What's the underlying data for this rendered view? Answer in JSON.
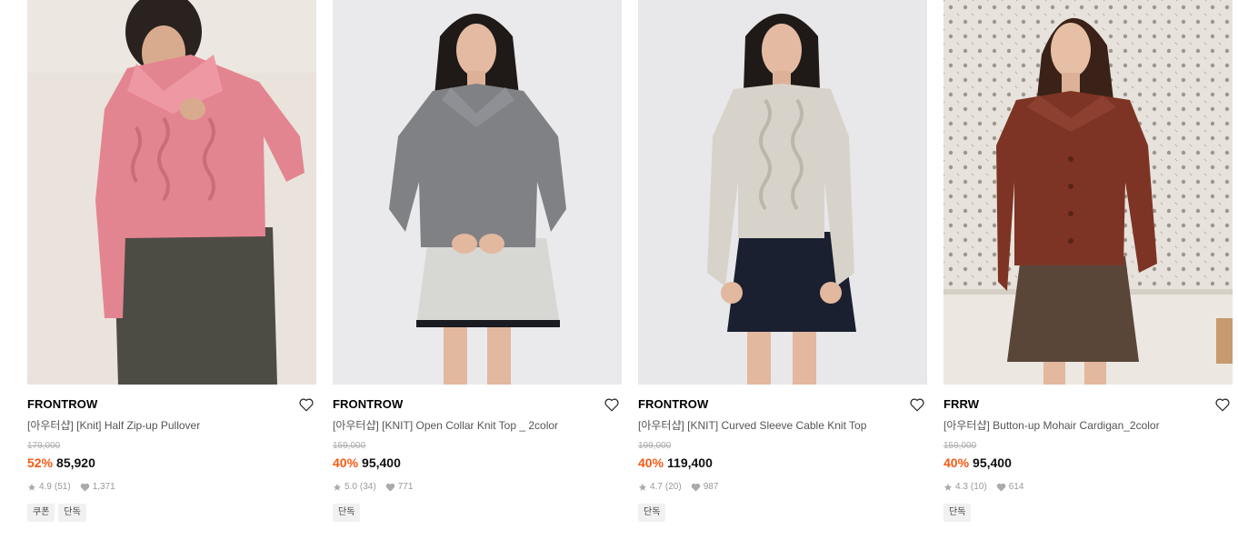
{
  "products": [
    {
      "brand": "FRONTROW",
      "title": "[아우터샵] [Knit] Half Zip-up Pullover",
      "original_price": "179,000",
      "discount": "52%",
      "price": "85,920",
      "rating": "4.9",
      "reviews": "(51)",
      "likes": "1,371",
      "tags": [
        "쿠폰",
        "단독"
      ]
    },
    {
      "brand": "FRONTROW",
      "title": "[아우터샵] [KNIT] Open Collar Knit Top _ 2color",
      "original_price": "159,000",
      "discount": "40%",
      "price": "95,400",
      "rating": "5.0",
      "reviews": "(34)",
      "likes": "771",
      "tags": [
        "단독"
      ]
    },
    {
      "brand": "FRONTROW",
      "title": "[아우터샵] [KNIT] Curved Sleeve Cable Knit Top",
      "original_price": "199,000",
      "discount": "40%",
      "price": "119,400",
      "rating": "4.7",
      "reviews": "(20)",
      "likes": "987",
      "tags": [
        "단독"
      ]
    },
    {
      "brand": "FRRW",
      "title": "[아우터샵] Button-up Mohair Cardigan_2color",
      "original_price": "159,000",
      "discount": "40%",
      "price": "95,400",
      "rating": "4.3",
      "reviews": "(10)",
      "likes": "614",
      "tags": [
        "단독"
      ]
    }
  ],
  "colors": {
    "discount": "#f35b15",
    "tag_bg": "#f1f1f1",
    "sweater_1": "#e38590",
    "sweater_2": "#7f8185",
    "sweater_3": "#d8d3ca",
    "sweater_4": "#7e3424"
  },
  "icons": {
    "like": "heart-outline-icon",
    "rating": "star-icon",
    "likes_count": "heart-filled-icon"
  }
}
